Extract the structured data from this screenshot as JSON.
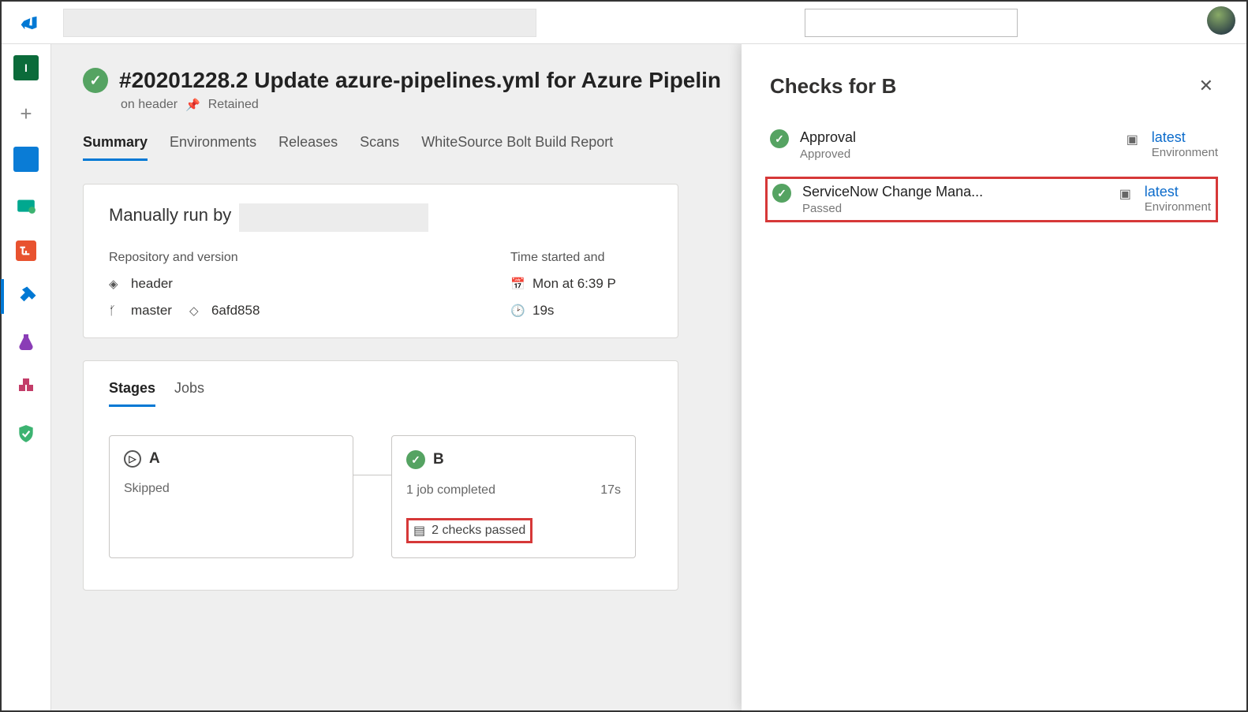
{
  "page": {
    "title": "#20201228.2 Update azure-pipelines.yml for Azure Pipelin",
    "branch_meta": "on header",
    "retained": "Retained"
  },
  "tabs": {
    "summary": "Summary",
    "environments": "Environments",
    "releases": "Releases",
    "scans": "Scans",
    "whitesource": "WhiteSource Bolt Build Report"
  },
  "run_card": {
    "heading": "Manually run by",
    "repo_label": "Repository and version",
    "repo_name": "header",
    "branch": "master",
    "commit": "6afd858",
    "time_label": "Time started and",
    "time_value": "Mon at 6:39 P",
    "duration": "19s"
  },
  "stages_card": {
    "tab_stages": "Stages",
    "tab_jobs": "Jobs",
    "stage_a": {
      "name": "A",
      "status": "Skipped"
    },
    "stage_b": {
      "name": "B",
      "jobs": "1 job completed",
      "duration": "17s",
      "checks": "2 checks passed"
    }
  },
  "panel": {
    "title": "Checks for B",
    "checks": [
      {
        "name": "Approval",
        "status": "Approved",
        "env_link": "latest",
        "env_label": "Environment"
      },
      {
        "name": "ServiceNow Change Mana...",
        "status": "Passed",
        "env_link": "latest",
        "env_label": "Environment"
      }
    ]
  }
}
